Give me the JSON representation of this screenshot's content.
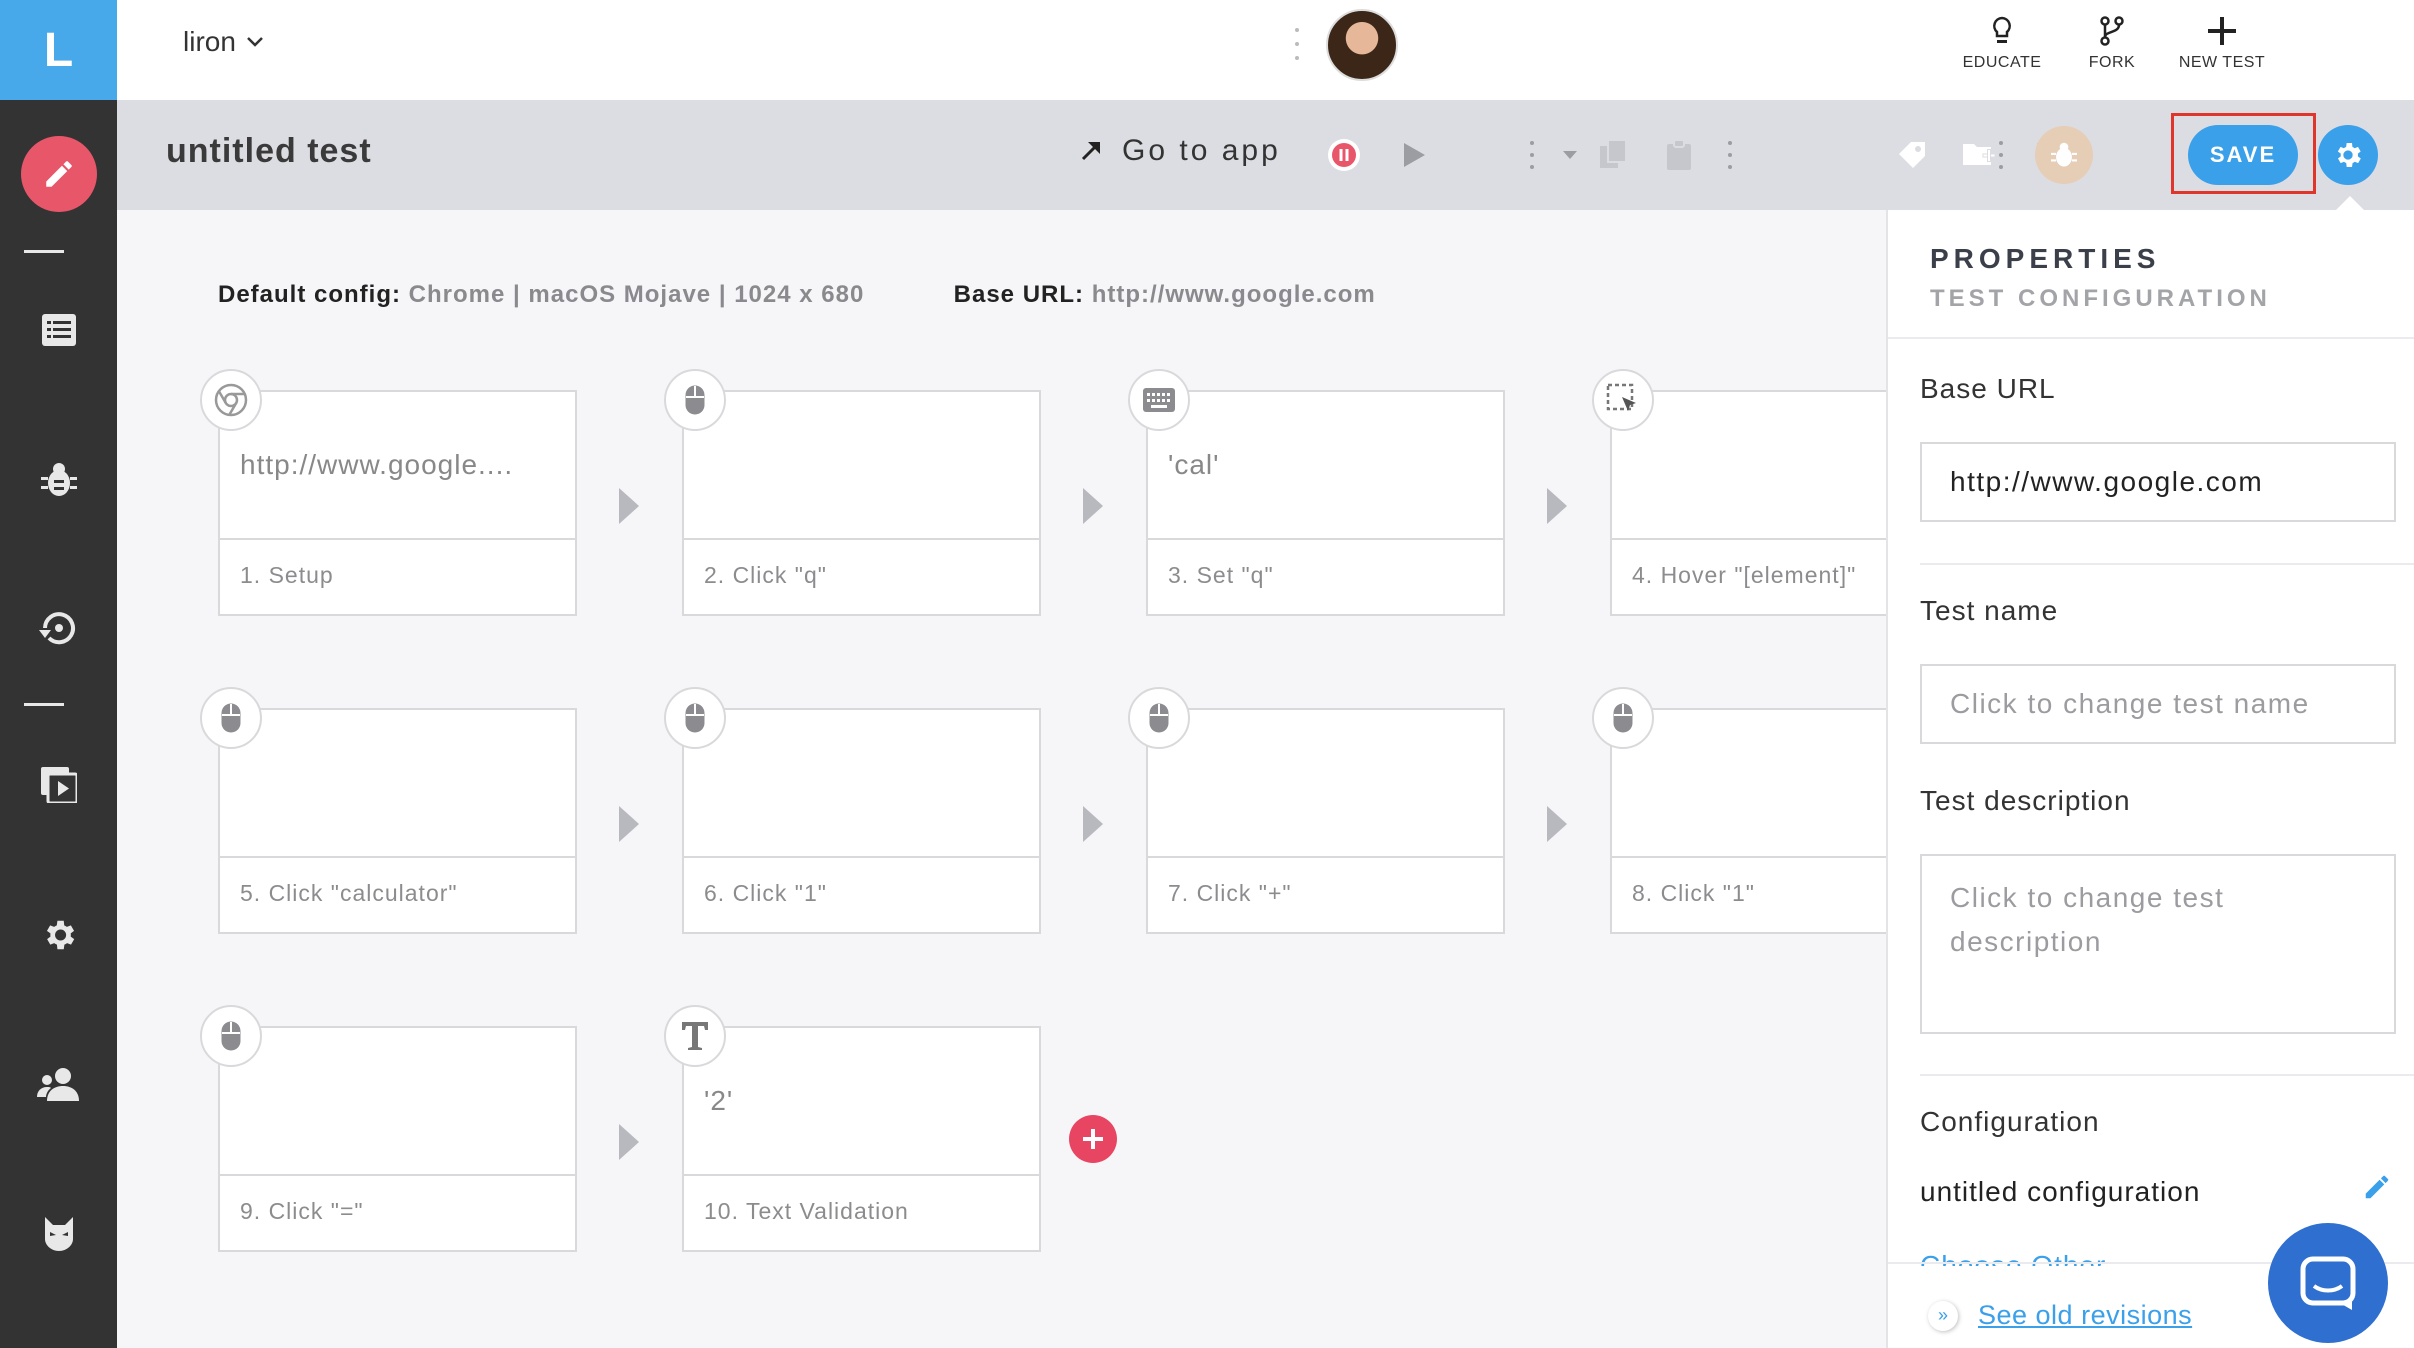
{
  "app": {
    "logo_letter": "L",
    "brand_color": "#47a9ea"
  },
  "topbar": {
    "user": "liron",
    "actions": [
      {
        "label": "EDUCATE",
        "icon": "lightbulb-icon"
      },
      {
        "label": "FORK",
        "icon": "fork-icon"
      },
      {
        "label": "NEW TEST",
        "icon": "plus-icon"
      }
    ]
  },
  "sidebar": {
    "items": [
      "edit-icon",
      "list-icon",
      "bug-icon",
      "schedule-icon",
      "playlist-icon",
      "settings-icon",
      "team-icon",
      "testim-mask-icon"
    ]
  },
  "toolbar": {
    "title": "untitled test",
    "go_to_app": "Go to app",
    "save_label": "SAVE",
    "save_color": "#3aa0ea",
    "highlight_color": "#e0352b"
  },
  "config": {
    "default_label": "Default config:",
    "default_value": "Chrome | macOS Mojave | 1024 x 680",
    "base_url_label": "Base URL:",
    "base_url_value": "http://www.google.com"
  },
  "steps": [
    {
      "title": "1. Setup",
      "value": "http://www.google....",
      "icon": "chrome-icon"
    },
    {
      "title": "2. Click \"q\"",
      "value": "",
      "icon": "mouse-icon"
    },
    {
      "title": "3. Set \"q\"",
      "value": "'cal'",
      "icon": "keyboard-icon"
    },
    {
      "title": "4. Hover \"[element]\"",
      "value": "",
      "icon": "hover-icon"
    },
    {
      "title": "5. Click \"calculator\"",
      "value": "",
      "icon": "mouse-icon"
    },
    {
      "title": "6. Click \"1\"",
      "value": "",
      "icon": "mouse-icon"
    },
    {
      "title": "7. Click \"+\"",
      "value": "",
      "icon": "mouse-icon"
    },
    {
      "title": "8. Click \"1\"",
      "value": "",
      "icon": "mouse-icon"
    },
    {
      "title": "9. Click \"=\"",
      "value": "",
      "icon": "mouse-icon"
    },
    {
      "title": "10. Text Validation",
      "value": "'2'",
      "icon": "text-icon"
    }
  ],
  "properties": {
    "title": "PROPERTIES",
    "subtitle": "TEST CONFIGURATION",
    "base_url_label": "Base URL",
    "base_url_value": "http://www.google.com",
    "test_name_label": "Test name",
    "test_name_placeholder": "Click to change test name",
    "description_label": "Test description",
    "description_placeholder": "Click to change test description",
    "configuration_label": "Configuration",
    "configuration_value": "untitled configuration",
    "choose_other": "Choose Other",
    "see_old_revisions": "See old revisions"
  }
}
